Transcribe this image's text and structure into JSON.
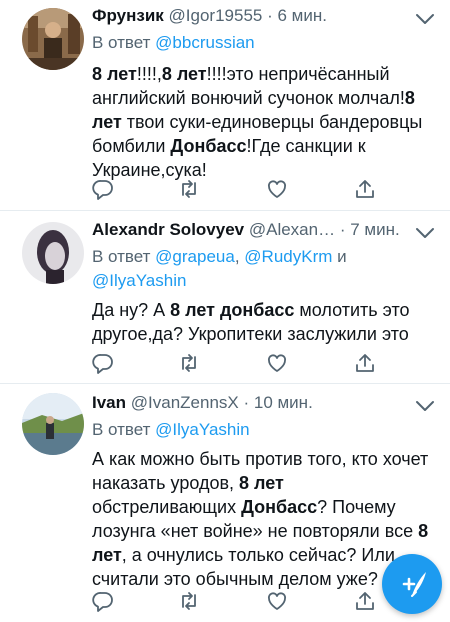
{
  "tweets": [
    {
      "name": "Фрунзик",
      "handle": "@Igor19555",
      "sep": " · ",
      "time": "6 мин.",
      "reply_prefix": "В ответ ",
      "reply_users": [
        "@bbcrussian"
      ],
      "body": [
        {
          "b": true,
          "t": "8 лет"
        },
        {
          "b": false,
          "t": "!!!!,"
        },
        {
          "b": true,
          "t": "8 лет"
        },
        {
          "b": false,
          "t": "!!!!это непричёсанный английский вонючий сучонок молчал!"
        },
        {
          "b": true,
          "t": "8 лет"
        },
        {
          "b": false,
          "t": " твои суки-единоверцы бандеровцы бомбили "
        },
        {
          "b": true,
          "t": "Донбасс"
        },
        {
          "b": false,
          "t": "!Где санкции к Украине,сука!"
        }
      ]
    },
    {
      "name": "Alexandr Solovyev",
      "handle": "@Alexan…",
      "sep": " · ",
      "time": "7 мин.",
      "reply_prefix": "В ответ ",
      "reply_users": [
        "@grapeua",
        "@RudyKrm",
        "@IlyaYashin"
      ],
      "reply_sep": ", ",
      "reply_and": " и",
      "body": [
        {
          "b": false,
          "t": "Да ну? А "
        },
        {
          "b": true,
          "t": "8 лет донбасс"
        },
        {
          "b": false,
          "t": " молотить это другое,да? Укропитеки заслужили это"
        }
      ]
    },
    {
      "name": "Ivan",
      "handle": "@IvanZennsX",
      "sep": " · ",
      "time": "10 мин.",
      "reply_prefix": "В ответ ",
      "reply_users": [
        "@IlyaYashin"
      ],
      "body": [
        {
          "b": false,
          "t": "А как можно быть против того, кто хочет наказать уродов, "
        },
        {
          "b": true,
          "t": "8 лет"
        },
        {
          "b": false,
          "t": " обстреливающих "
        },
        {
          "b": true,
          "t": "Донбасс"
        },
        {
          "b": false,
          "t": "? Почему лозунга «нет войне» не повторяли все "
        },
        {
          "b": true,
          "t": "8 лет"
        },
        {
          "b": false,
          "t": ", а очнулись только сейчас? Или считали это обычным делом уже?"
        }
      ]
    }
  ],
  "icons": {
    "more": "chevron-down-icon",
    "reply": "reply-icon",
    "retweet": "retweet-icon",
    "like": "heart-icon",
    "share": "share-icon",
    "compose": "compose-tweet-icon"
  },
  "colors": {
    "accent": "#1d9bf0",
    "text": "#0f1419",
    "muted": "#536471",
    "divider": "#e6ecf0"
  }
}
